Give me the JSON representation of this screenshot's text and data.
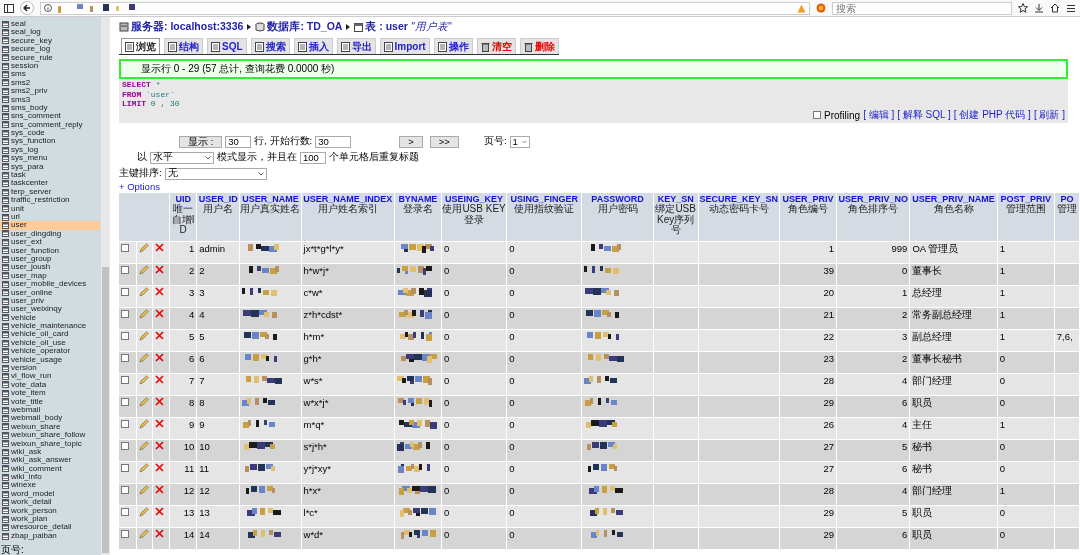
{
  "browser": {
    "search": {
      "placeholder": "搜索"
    }
  },
  "sidebar": {
    "items": [
      {
        "label": "seal",
        "selected": false
      },
      {
        "label": "seal_log",
        "selected": false
      },
      {
        "label": "secure_key",
        "selected": false
      },
      {
        "label": "secure_log",
        "selected": false
      },
      {
        "label": "secure_rule",
        "selected": false
      },
      {
        "label": "session",
        "selected": false
      },
      {
        "label": "sms",
        "selected": false
      },
      {
        "label": "sms2",
        "selected": false
      },
      {
        "label": "sms2_priv",
        "selected": false
      },
      {
        "label": "sms3",
        "selected": false
      },
      {
        "label": "sms_body",
        "selected": false
      },
      {
        "label": "sns_comment",
        "selected": false
      },
      {
        "label": "sns_comment_reply",
        "selected": false
      },
      {
        "label": "sys_code",
        "selected": false
      },
      {
        "label": "sys_function",
        "selected": false
      },
      {
        "label": "sys_log",
        "selected": false
      },
      {
        "label": "sys_menu",
        "selected": false
      },
      {
        "label": "sys_para",
        "selected": false
      },
      {
        "label": "task",
        "selected": false
      },
      {
        "label": "taskcenter",
        "selected": false
      },
      {
        "label": "terp_server",
        "selected": false
      },
      {
        "label": "traffic_restriction",
        "selected": false
      },
      {
        "label": "unit",
        "selected": false
      },
      {
        "label": "url",
        "selected": false
      },
      {
        "label": "user",
        "selected": true
      },
      {
        "label": "user_dingding",
        "selected": false
      },
      {
        "label": "user_ext",
        "selected": false
      },
      {
        "label": "user_function",
        "selected": false
      },
      {
        "label": "user_group",
        "selected": false
      },
      {
        "label": "user_joush",
        "selected": false
      },
      {
        "label": "user_map",
        "selected": false
      },
      {
        "label": "user_mobile_devices",
        "selected": false
      },
      {
        "label": "user_online",
        "selected": false
      },
      {
        "label": "user_priv",
        "selected": false
      },
      {
        "label": "user_weixinqy",
        "selected": false
      },
      {
        "label": "vehicle",
        "selected": false
      },
      {
        "label": "vehicle_maintenance",
        "selected": false
      },
      {
        "label": "vehicle_oil_card",
        "selected": false
      },
      {
        "label": "vehicle_oil_use",
        "selected": false
      },
      {
        "label": "vehicle_operator",
        "selected": false
      },
      {
        "label": "vehicle_usage",
        "selected": false
      },
      {
        "label": "version",
        "selected": false
      },
      {
        "label": "vi_flow_run",
        "selected": false
      },
      {
        "label": "vote_data",
        "selected": false
      },
      {
        "label": "vote_item",
        "selected": false
      },
      {
        "label": "vote_title",
        "selected": false
      },
      {
        "label": "webmail",
        "selected": false
      },
      {
        "label": "webmail_body",
        "selected": false
      },
      {
        "label": "weixun_share",
        "selected": false
      },
      {
        "label": "weixun_share_follow",
        "selected": false
      },
      {
        "label": "weixun_share_topic",
        "selected": false
      },
      {
        "label": "wiki_ask",
        "selected": false
      },
      {
        "label": "wiki_ask_answer",
        "selected": false
      },
      {
        "label": "wiki_comment",
        "selected": false
      },
      {
        "label": "wiki_info",
        "selected": false
      },
      {
        "label": "winexe",
        "selected": false
      },
      {
        "label": "word_model",
        "selected": false
      },
      {
        "label": "work_detail",
        "selected": false
      },
      {
        "label": "work_person",
        "selected": false
      },
      {
        "label": "work_plan",
        "selected": false
      },
      {
        "label": "wresource_detail",
        "selected": false
      },
      {
        "label": "zbap_paiban",
        "selected": false
      }
    ],
    "footer": "页号:"
  },
  "breadcrumb": [
    {
      "kind": "server",
      "label": "服务器: localhost:3336"
    },
    {
      "kind": "database",
      "label": "数据库: TD_OA"
    },
    {
      "kind": "table",
      "label": "表 : user",
      "comment": "\"用户表\""
    }
  ],
  "tabs": [
    {
      "label": "浏览",
      "selected": true,
      "kind": "normal"
    },
    {
      "label": "结构",
      "selected": false,
      "kind": "normal"
    },
    {
      "label": "SQL",
      "selected": false,
      "kind": "normal"
    },
    {
      "label": "搜索",
      "selected": false,
      "kind": "normal"
    },
    {
      "label": "插入",
      "selected": false,
      "kind": "normal"
    },
    {
      "label": "导出",
      "selected": false,
      "kind": "normal"
    },
    {
      "label": "Import",
      "selected": false,
      "kind": "normal"
    },
    {
      "label": "操作",
      "selected": false,
      "kind": "normal"
    },
    {
      "label": "清空",
      "selected": false,
      "kind": "danger"
    },
    {
      "label": "删除",
      "selected": false,
      "kind": "danger"
    }
  ],
  "message": "显示行 0 - 29 (57 总计, 查询花费 0.0000 秒)",
  "sql": [
    {
      "keyword": "SELECT",
      "rest": "*"
    },
    {
      "keyword": "FROM",
      "rest": "`user`"
    },
    {
      "keyword": "LIMIT",
      "rest": "0 , 30"
    }
  ],
  "profiling": {
    "label": "Profiling",
    "checked": false,
    "links": [
      "[ 编辑 ]",
      "[ 解释 SQL ]",
      "[ 创建 PHP 代码 ]",
      "[ 刷新 ]"
    ]
  },
  "nav": {
    "show_button": "显示 :",
    "rows": "30",
    "rows_label": "行, 开始行数:",
    "start": "30",
    "next": ">",
    "last": ">>",
    "page_label": "页号:",
    "page": "1",
    "mode_prefix": "以",
    "mode": "水平",
    "mode_label": "模式显示，并且在",
    "repeat": "100",
    "repeat_label": "个单元格后重复标题",
    "sort_label": "主键排序:",
    "sort": "无",
    "options": "+ Options"
  },
  "table": {
    "columns": [
      {
        "name": "UID",
        "note": "唯一自增ID",
        "kind": "number"
      },
      {
        "name": "USER_ID",
        "note": "用户名",
        "kind": "text"
      },
      {
        "name": "USER_NAME",
        "note": "用户真实姓名",
        "kind": "redacted"
      },
      {
        "name": "USER_NAME_INDEX",
        "note": "用户姓名索引",
        "kind": "text"
      },
      {
        "name": "BYNAME",
        "note": "登录名",
        "kind": "redacted"
      },
      {
        "name": "USEING_KEY",
        "note": "使用USB KEY登录",
        "kind": "text"
      },
      {
        "name": "USING_FINGER",
        "note": "使用指纹验证",
        "kind": "text"
      },
      {
        "name": "PASSWORD",
        "note": "用户密码",
        "kind": "redacted"
      },
      {
        "name": "KEY_SN",
        "note": "绑定USB Key序列号",
        "kind": "empty"
      },
      {
        "name": "SECURE_KEY_SN",
        "note": "动态密码卡号",
        "kind": "empty"
      },
      {
        "name": "USER_PRIV",
        "note": "角色编号",
        "kind": "number"
      },
      {
        "name": "USER_PRIV_NO",
        "note": "角色排序号",
        "kind": "number"
      },
      {
        "name": "USER_PRIV_NAME",
        "note": "角色名称",
        "kind": "text"
      },
      {
        "name": "POST_PRIV",
        "note": "管理范围",
        "kind": "text"
      },
      {
        "name": "PO",
        "note": "管理",
        "kind": "text"
      }
    ],
    "rows": [
      {
        "checked": false,
        "cells": [
          "1",
          "admin",
          "",
          "jx*t*g*l*y*",
          "",
          "0",
          "0",
          "",
          "",
          "",
          "1",
          "999",
          "OA 管理员",
          "1"
        ]
      },
      {
        "checked": false,
        "cells": [
          "2",
          "2",
          "",
          "h*w*j*",
          "",
          "0",
          "0",
          "",
          "",
          "",
          "39",
          "0",
          "董事长",
          "1"
        ]
      },
      {
        "checked": false,
        "cells": [
          "3",
          "3",
          "",
          "c*w*",
          "",
          "0",
          "0",
          "",
          "",
          "",
          "20",
          "1",
          "总经理",
          "1"
        ]
      },
      {
        "checked": false,
        "cells": [
          "4",
          "4",
          "",
          "z*h*cdst*",
          "",
          "0",
          "0",
          "",
          "",
          "",
          "21",
          "2",
          "常务副总经理",
          "1"
        ]
      },
      {
        "checked": false,
        "cells": [
          "5",
          "5",
          "",
          "h*m*",
          "",
          "0",
          "0",
          "",
          "",
          "",
          "22",
          "3",
          "副总经理",
          "1",
          "7,6,"
        ]
      },
      {
        "checked": false,
        "cells": [
          "6",
          "6",
          "",
          "g*h*",
          "",
          "0",
          "0",
          "",
          "",
          "",
          "23",
          "2",
          "董事长秘书",
          "0"
        ]
      },
      {
        "checked": false,
        "cells": [
          "7",
          "7",
          "",
          "w*s*",
          "",
          "0",
          "0",
          "",
          "",
          "",
          "28",
          "4",
          "部门经理",
          "0"
        ]
      },
      {
        "checked": false,
        "cells": [
          "8",
          "8",
          "",
          "w*x*j*",
          "",
          "0",
          "0",
          "",
          "",
          "",
          "29",
          "6",
          "职员",
          "0"
        ]
      },
      {
        "checked": false,
        "cells": [
          "9",
          "9",
          "",
          "m*q*",
          "",
          "0",
          "0",
          "",
          "",
          "",
          "26",
          "4",
          "主任",
          "1"
        ]
      },
      {
        "checked": false,
        "cells": [
          "10",
          "10",
          "",
          "s*j*h*",
          "",
          "0",
          "0",
          "",
          "",
          "",
          "27",
          "5",
          "秘书",
          "0"
        ]
      },
      {
        "checked": false,
        "cells": [
          "11",
          "11",
          "",
          "y*j*xy*",
          "",
          "0",
          "0",
          "",
          "",
          "",
          "27",
          "6",
          "秘书",
          "0"
        ]
      },
      {
        "checked": false,
        "cells": [
          "12",
          "12",
          "",
          "h*x*",
          "",
          "0",
          "0",
          "",
          "",
          "",
          "28",
          "4",
          "部门经理",
          "1"
        ]
      },
      {
        "checked": false,
        "cells": [
          "13",
          "13",
          "",
          "l*c*",
          "",
          "0",
          "0",
          "",
          "",
          "",
          "29",
          "5",
          "职员",
          "0"
        ]
      },
      {
        "checked": false,
        "cells": [
          "14",
          "14",
          "",
          "w*d*",
          "",
          "0",
          "0",
          "",
          "",
          "",
          "29",
          "6",
          "职员",
          "0"
        ]
      }
    ]
  }
}
